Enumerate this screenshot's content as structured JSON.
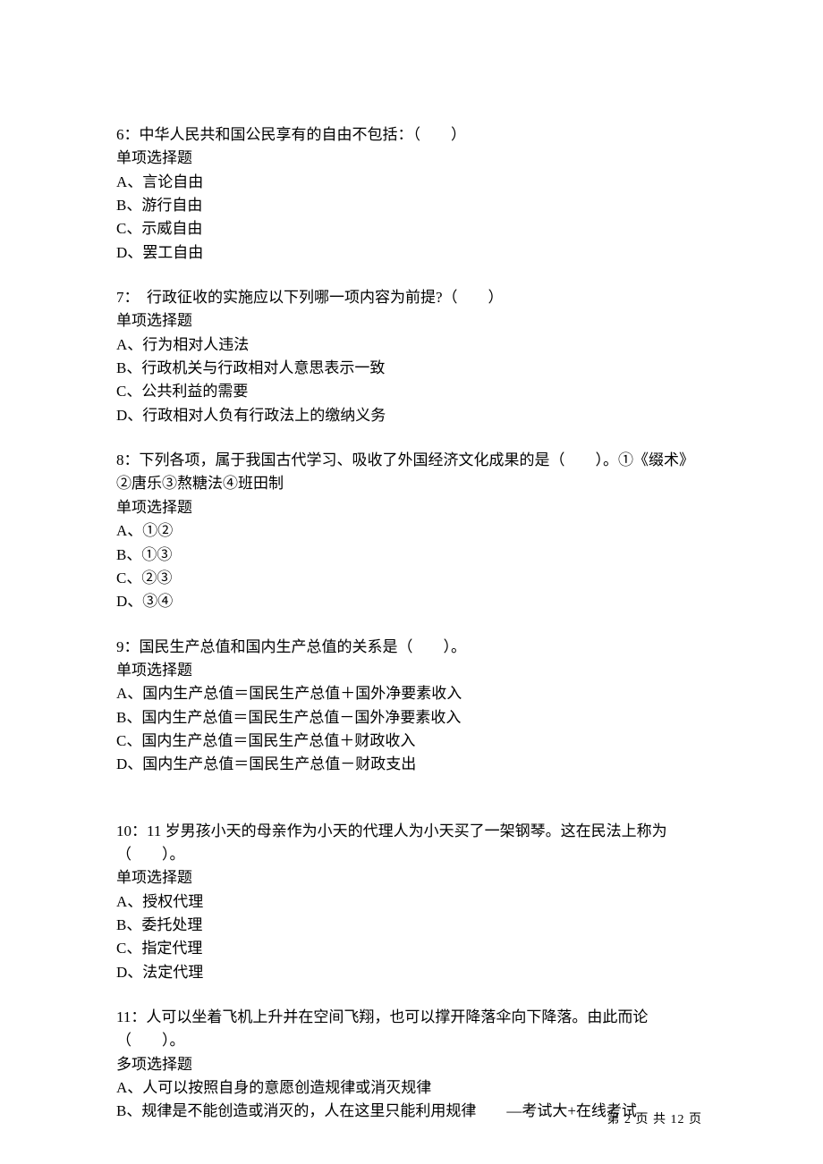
{
  "questions": [
    {
      "stem": "6：中华人民共和国公民享有的自由不包括：（　　）",
      "type": "单项选择题",
      "options": [
        "A、言论自由",
        "B、游行自由",
        "C、示威自由",
        "D、罢工自由"
      ]
    },
    {
      "stem": "7：　行政征收的实施应以下列哪一项内容为前提?（　　）",
      "type": "单项选择题",
      "options": [
        "A、行为相对人违法",
        "B、行政机关与行政相对人意思表示一致",
        "C、公共利益的需要",
        "D、行政相对人负有行政法上的缴纳义务"
      ]
    },
    {
      "stem": "8：下列各项，属于我国古代学习、吸收了外国经济文化成果的是（　　）。①《缀术》②唐乐③熬糖法④班田制",
      "type": "单项选择题",
      "options": [
        "A、①②",
        "B、①③",
        "C、②③",
        "D、③④"
      ]
    },
    {
      "stem": "9：国民生产总值和国内生产总值的关系是（　　）。",
      "type": "单项选择题",
      "options": [
        "A、国内生产总值＝国民生产总值＋国外净要素收入",
        "B、国内生产总值＝国民生产总值－国外净要素收入",
        "C、国内生产总值＝国民生产总值＋财政收入",
        "D、国内生产总值＝国民生产总值－财政支出"
      ]
    },
    {
      "stem": "10：11 岁男孩小天的母亲作为小天的代理人为小天买了一架钢琴。这在民法上称为（　　）。",
      "type": "单项选择题",
      "options": [
        "A、授权代理",
        "B、委托处理",
        "C、指定代理",
        "D、法定代理"
      ]
    },
    {
      "stem": "11：人可以坐着飞机上升并在空间飞翔，也可以撑开降落伞向下降落。由此而论（　　）。",
      "type": "多项选择题",
      "options": [
        "A、人可以按照自身的意愿创造规律或消灭规律",
        "B、规律是不能创造或消灭的，人在这里只能利用规律　　—考试大+在线考试"
      ]
    }
  ],
  "footer": "第 2 页 共 12 页",
  "extra_gap_after_index": 3
}
